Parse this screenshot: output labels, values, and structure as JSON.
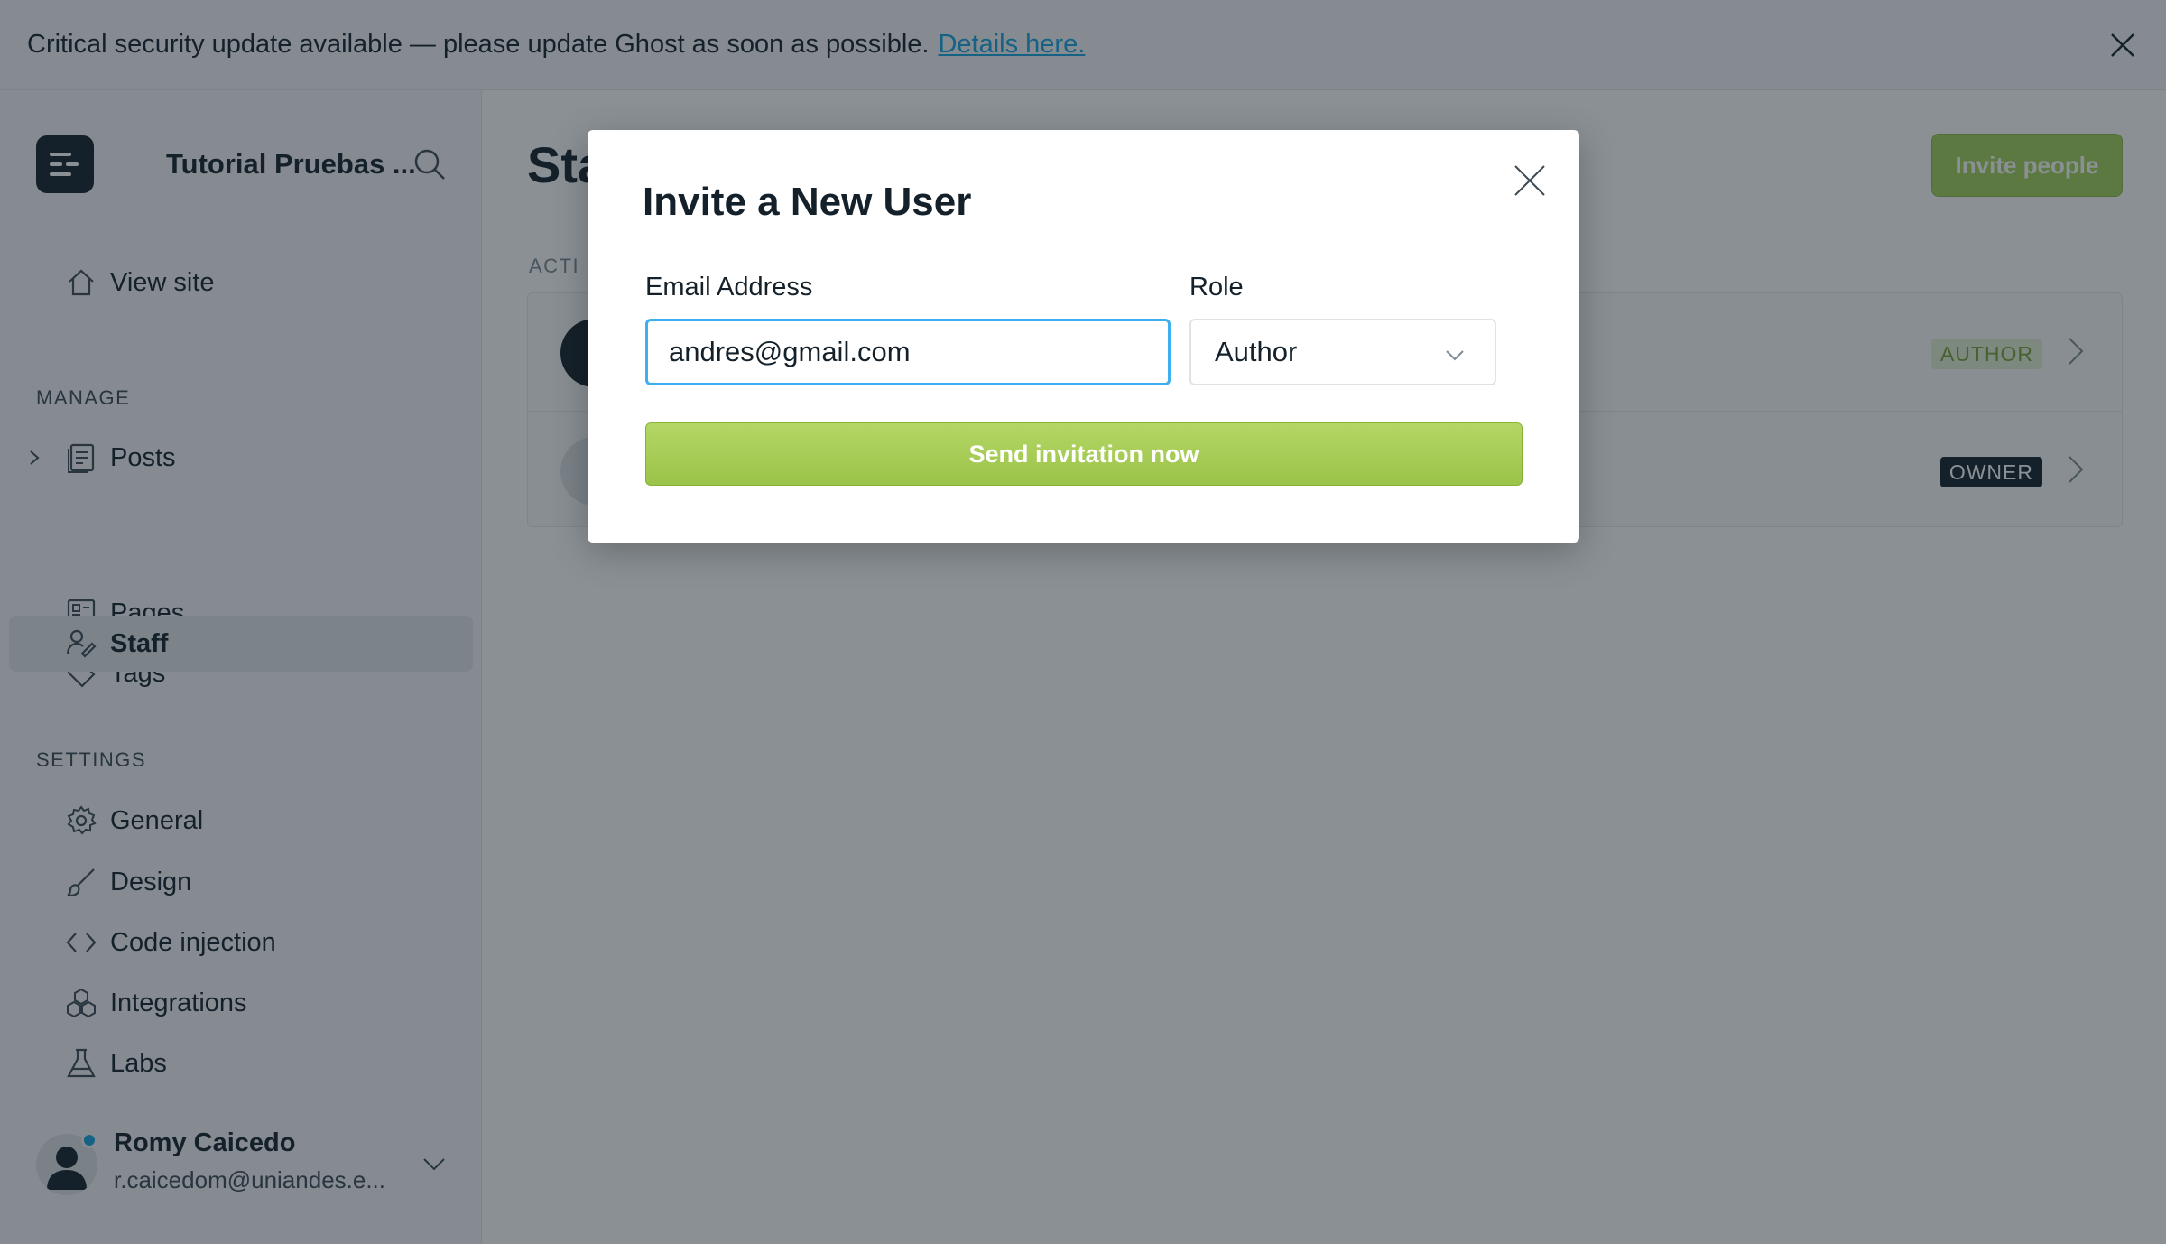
{
  "banner": {
    "message": "Critical security update available — please update Ghost as soon as possible.",
    "link": "Details here."
  },
  "sidebar": {
    "site_name": "Tutorial Pruebas ...",
    "view_site": "View site",
    "manage_title": "MANAGE",
    "manage_items": [
      {
        "label": "Posts",
        "icon": "posts-icon"
      },
      {
        "label": "Pages",
        "icon": "pages-icon"
      },
      {
        "label": "Tags",
        "icon": "tag-icon"
      },
      {
        "label": "Staff",
        "icon": "staff-icon",
        "active": true
      }
    ],
    "settings_title": "SETTINGS",
    "settings_items": [
      {
        "label": "General",
        "icon": "gear-icon"
      },
      {
        "label": "Design",
        "icon": "brush-icon"
      },
      {
        "label": "Code injection",
        "icon": "code-icon"
      },
      {
        "label": "Integrations",
        "icon": "integrations-icon"
      },
      {
        "label": "Labs",
        "icon": "flask-icon"
      }
    ],
    "user": {
      "name": "Romy Caicedo",
      "email": "r.caicedom@uniandes.e..."
    }
  },
  "main": {
    "title_visible": "Sta",
    "invite_button": "Invite people",
    "active_label": "ACTI",
    "staff": [
      {
        "role": "AUTHOR"
      },
      {
        "role": "OWNER"
      }
    ]
  },
  "modal": {
    "title": "Invite a New User",
    "email_label": "Email Address",
    "email_value": "andres@gmail.com",
    "role_label": "Role",
    "role_value": "Author",
    "send_button": "Send invitation now"
  }
}
